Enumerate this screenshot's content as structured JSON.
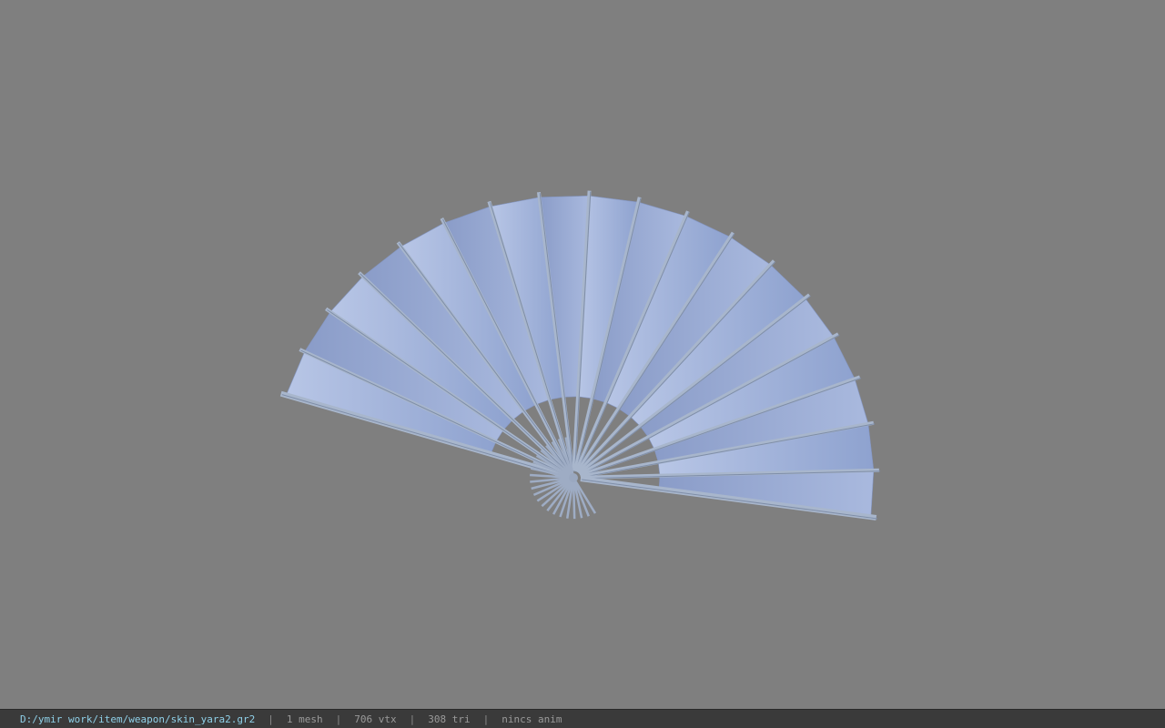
{
  "viewport": {
    "background": "#7f7f7f",
    "model_name": "folding-fan",
    "paper_color": "#9fb1db",
    "rib_color": "#a8b6cc",
    "rib_count": 19
  },
  "status_bar": {
    "file_path": "D:/ymir work/item/weapon/skin_yara2.gr2",
    "separator": "|",
    "mesh_count": "1 mesh",
    "vertex_count": "706 vtx",
    "triangle_count": "308 tri",
    "anim_state": "nincs anim"
  }
}
